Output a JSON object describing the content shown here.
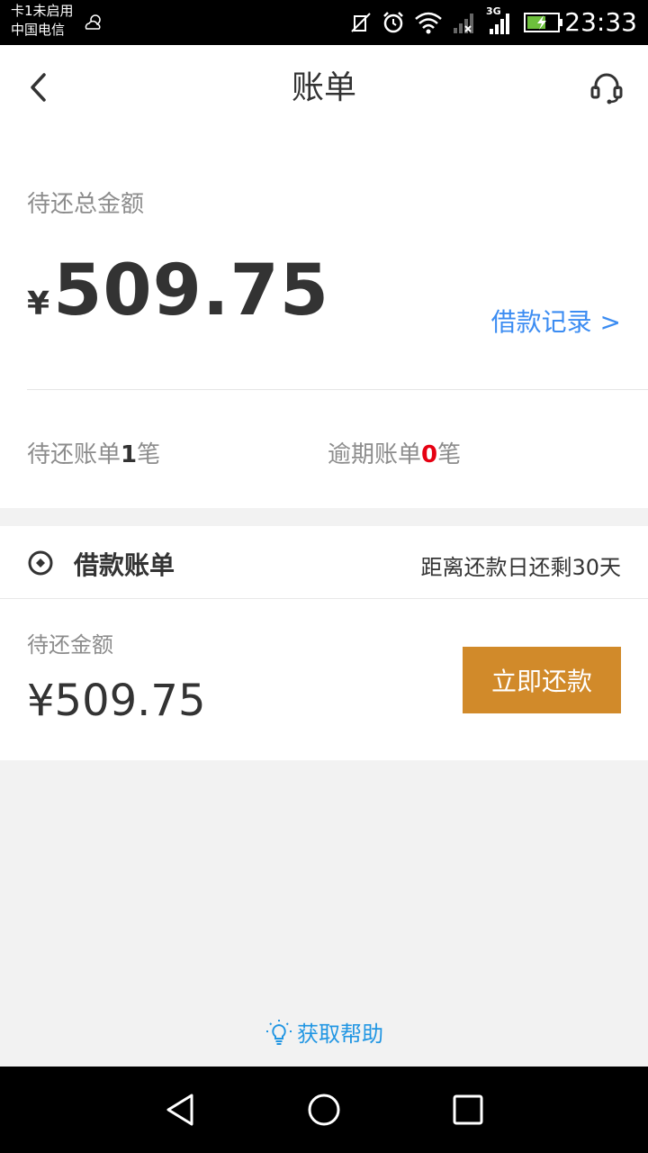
{
  "status_bar": {
    "sim_status": "卡1未启用",
    "carrier": "中国电信",
    "network_type": "3G",
    "time": "23:33"
  },
  "header": {
    "title": "账单",
    "back_icon": "chevron-left-icon",
    "service_icon": "headset-icon"
  },
  "summary": {
    "total_label": "待还总金额",
    "currency": "¥",
    "total_amount": "509.75",
    "loan_record_link": "借款记录 >",
    "pending_prefix": "待还账单",
    "pending_count": "1",
    "pending_suffix": "笔",
    "overdue_prefix": "逾期账单",
    "overdue_count": "0",
    "overdue_suffix": "笔"
  },
  "bill": {
    "title": "借款账单",
    "days_remaining": "距离还款日还剩30天",
    "due_label": "待还金额",
    "due_amount": "¥509.75",
    "pay_button": "立即还款"
  },
  "help": {
    "label": "获取帮助",
    "icon": "lightbulb-icon"
  },
  "colors": {
    "accent_blue": "#3b8cf2",
    "pay_button": "#d18a2a",
    "overdue_red": "#e60012",
    "help_blue": "#2196e3"
  }
}
